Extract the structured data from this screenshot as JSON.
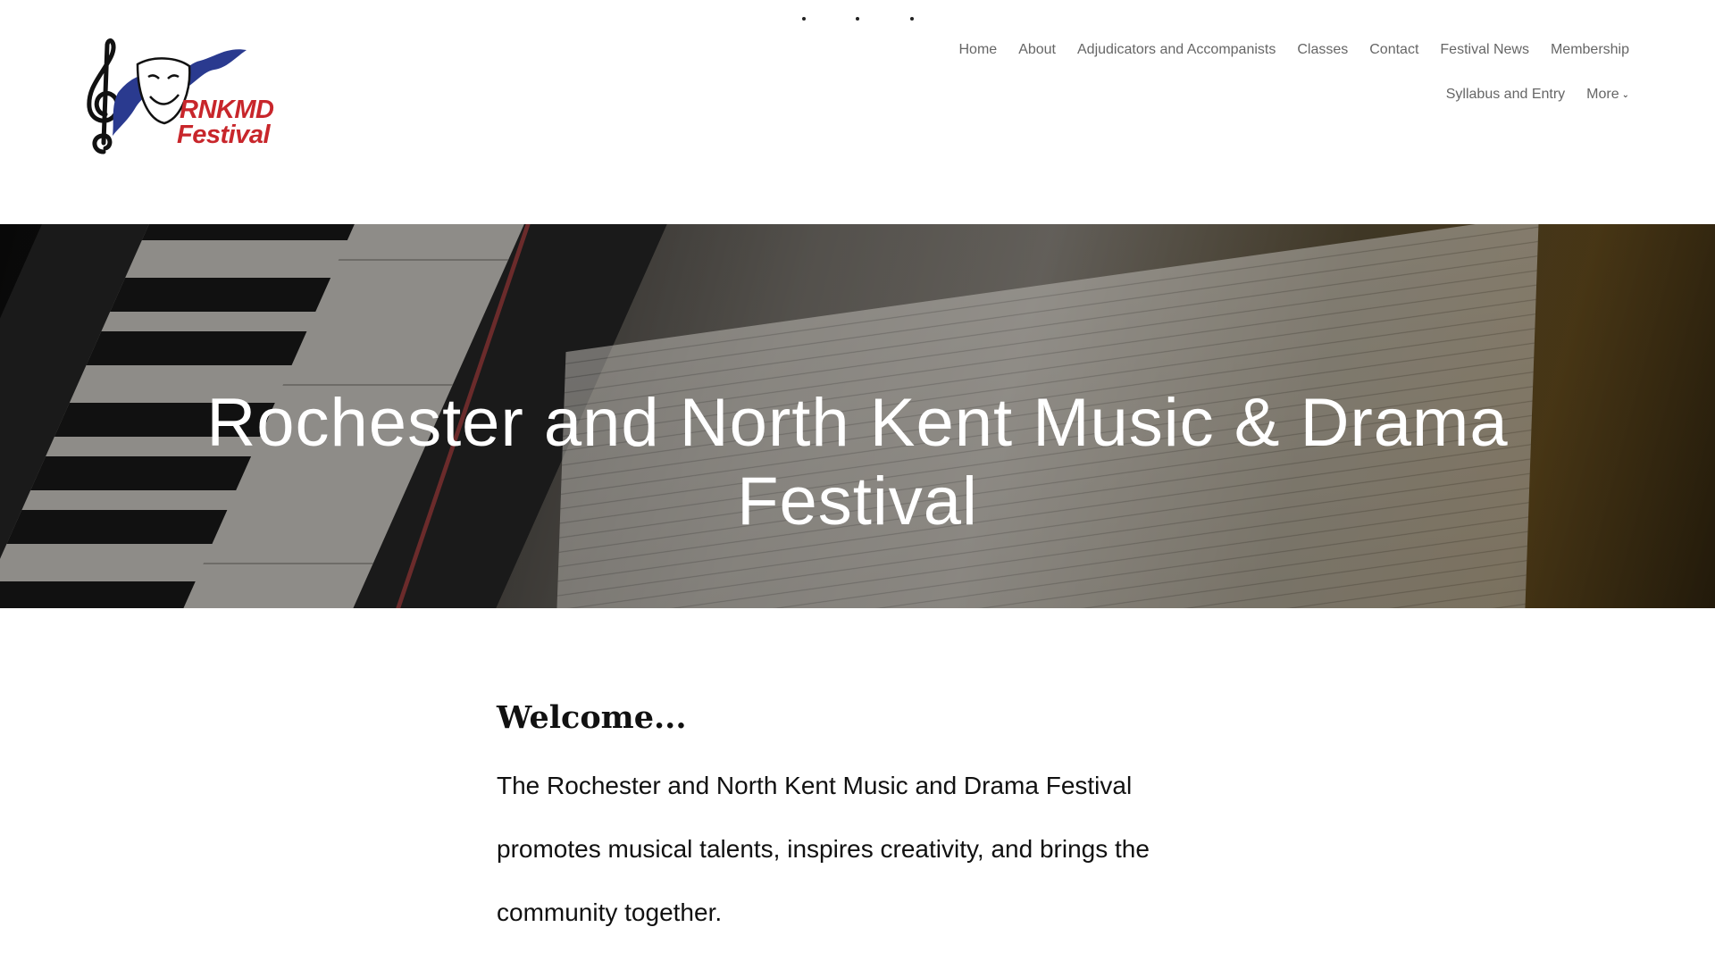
{
  "logo": {
    "line1": "RNKMD",
    "line2": "Festival"
  },
  "nav": {
    "row1": [
      "Home",
      "About",
      "Adjudicators and Accompanists",
      "Classes",
      "Contact",
      "Festival News",
      "Membership"
    ],
    "row2": [
      "Syllabus and Entry",
      "More"
    ]
  },
  "hero": {
    "title": "Rochester and North Kent Music & Drama Festival"
  },
  "main": {
    "heading": "Welcome...",
    "paragraph": "The Rochester and North Kent Music and Drama Festival promotes musical talents, inspires creativity, and brings the community together."
  },
  "colors": {
    "logo_red": "#c8262b",
    "logo_blue": "#2a3a8f",
    "nav_text": "#666666"
  }
}
